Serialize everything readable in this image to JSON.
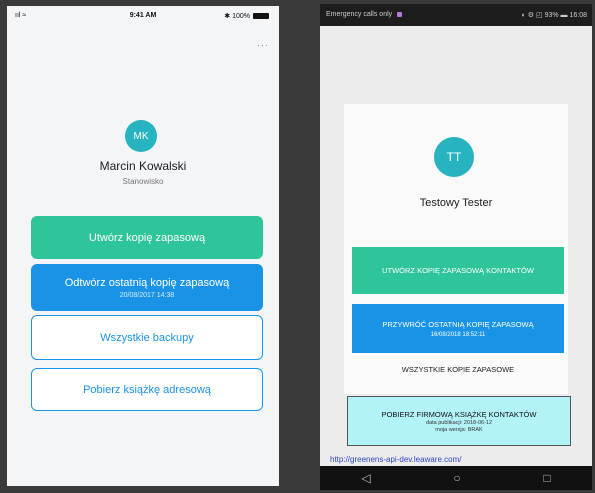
{
  "ios": {
    "status_left": "ııl ≈",
    "time": "9:41 AM",
    "status_right": "✱ 100%",
    "more": "···",
    "avatar_initials": "MK",
    "name": "Marcin Kowalski",
    "role": "Stanowisko",
    "create_backup": "Utwórz kopię zapasową",
    "restore_backup": "Odtwórz ostatnią kopię zapasową",
    "restore_date": "20/08/2017 14:38",
    "all_backups": "Wszystkie backupy",
    "download_addressbook": "Pobierz książkę adresową"
  },
  "android": {
    "status_left": "Emergency calls only",
    "status_right": "◐ ⚙ ◰ 93% ▬ 16:08",
    "avatar_initials": "TT",
    "name": "Testowy Tester",
    "create_backup": "UTWÓRZ KOPIĘ ZAPASOWĄ KONTAKTÓW",
    "restore_backup": "PRZYWRÓĆ OSTATNIĄ KOPIĘ ZAPASOWĄ",
    "restore_date": "16/08/2018 18:52:11",
    "all_backups": "WSZYSTKIE KOPIE ZAPASOWE",
    "download_company": "POBIERZ FIRMOWĄ KSIĄŻKĘ KONTAKTÓW",
    "publish_date": "data publikacji: 2018-06-12",
    "my_version": "moja wersja: BRAK",
    "link": "http://greenens-api-dev.leaware.com/",
    "nav_back": "◁",
    "nav_home": "○",
    "nav_recent": "□"
  },
  "colors": {
    "accent_green": "#2fc59a",
    "accent_blue": "#1993e6",
    "avatar_teal": "#27b3c0",
    "contact_box": "#b2f3f7"
  }
}
